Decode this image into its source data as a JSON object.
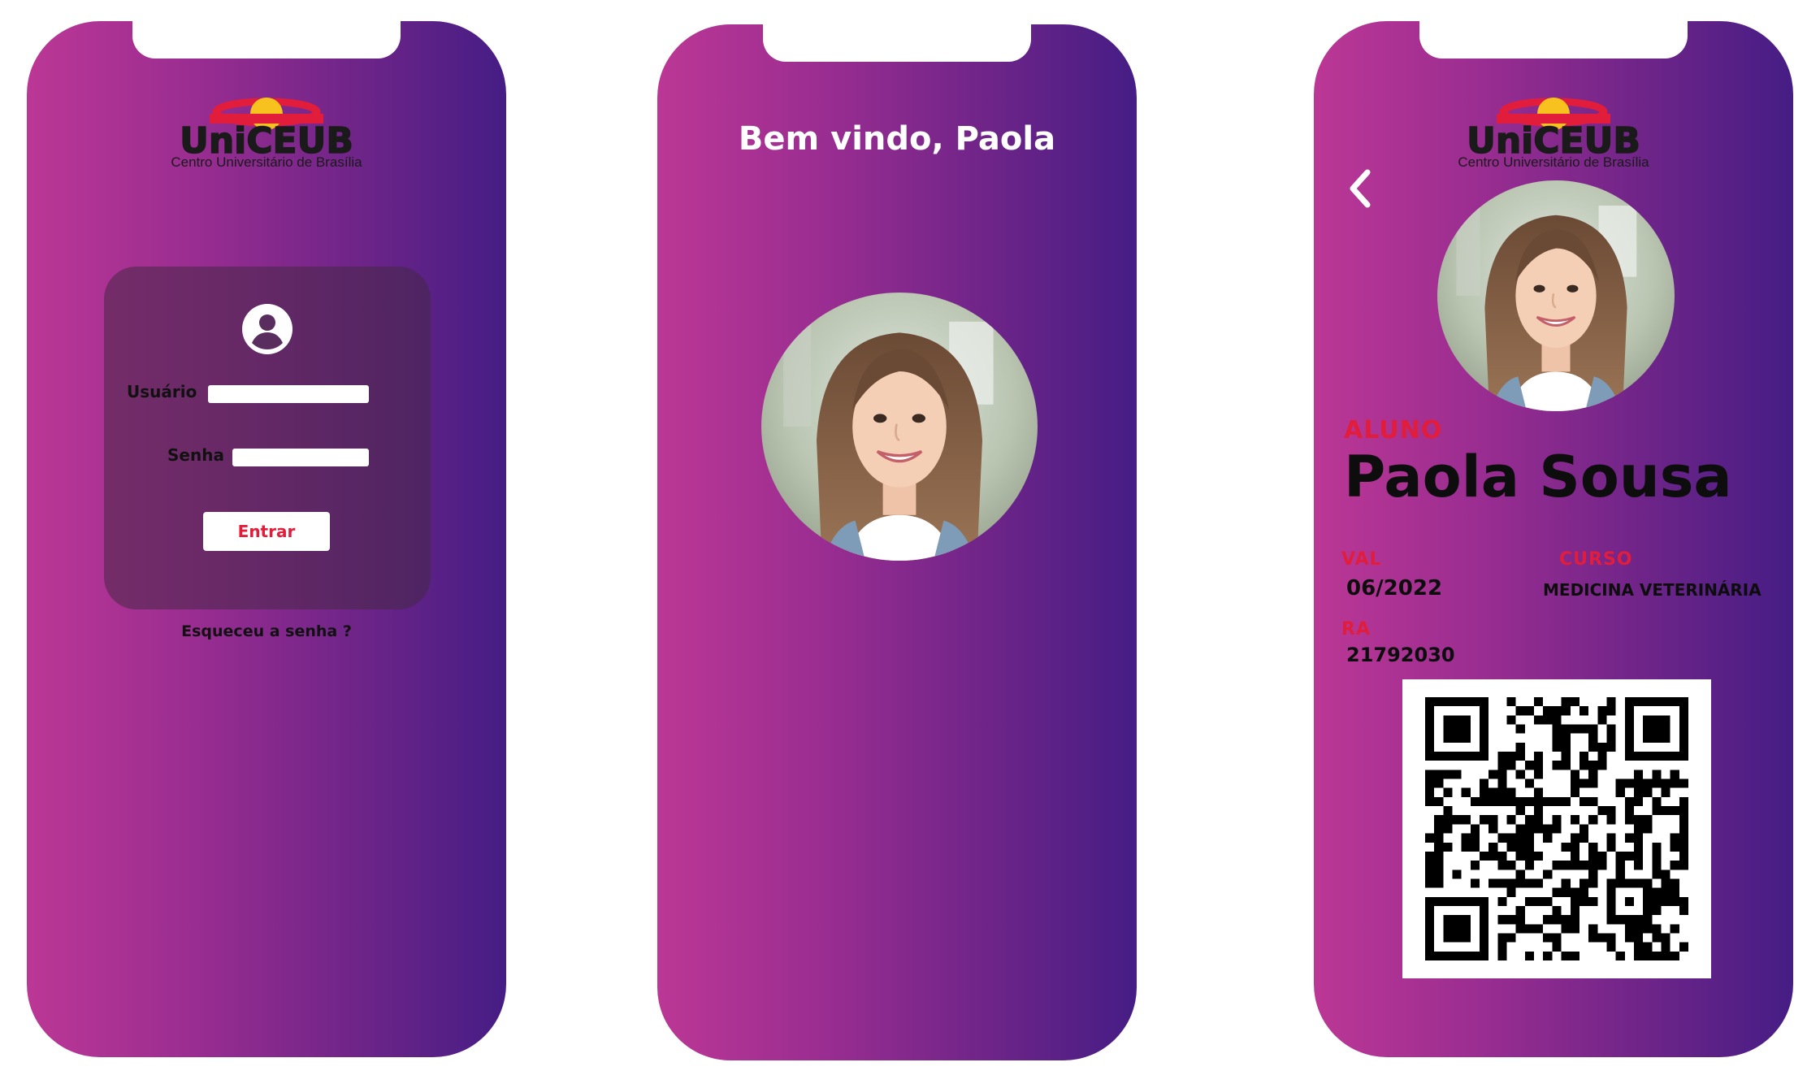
{
  "brand": {
    "name": "UniCEUB",
    "subtitle": "Centro Universitário de Brasília",
    "colors": {
      "red": "#e21d3b",
      "yellow": "#f7c21d",
      "dark": "#1a1a1a"
    }
  },
  "theme": {
    "gradient_start": "#bb3795",
    "gradient_end": "#451d85"
  },
  "login": {
    "user_icon": "user-circle-icon",
    "username_label": "Usuário",
    "username_value": "",
    "password_label": "Senha",
    "password_value": "",
    "submit_label": "Entrar",
    "forgot_label": "Esqueceu a senha ?"
  },
  "welcome": {
    "title": "Bem vindo, Paola"
  },
  "id_card": {
    "back_icon": "chevron-left-icon",
    "role_label": "ALUNO",
    "student_name": "Paola Sousa",
    "validity_label": "VAL",
    "validity_value": "06/2022",
    "course_label": "CURSO",
    "course_value": "MEDICINA VETERINÁRIA",
    "ra_label": "RA",
    "ra_value": "21792030",
    "qr_icon": "qr-code"
  }
}
